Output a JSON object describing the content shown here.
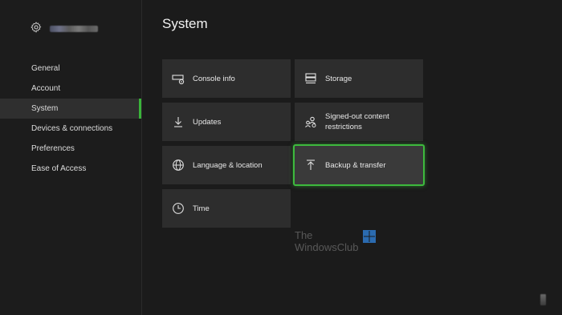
{
  "sidebar": {
    "items": [
      {
        "label": "General"
      },
      {
        "label": "Account"
      },
      {
        "label": "System",
        "active": true
      },
      {
        "label": "Devices & connections"
      },
      {
        "label": "Preferences"
      },
      {
        "label": "Ease of Access"
      }
    ]
  },
  "main": {
    "title": "System",
    "tiles": [
      {
        "label": "Console info",
        "icon": "console-info-icon"
      },
      {
        "label": "Storage",
        "icon": "storage-icon"
      },
      {
        "label": "Updates",
        "icon": "download-arrow-icon"
      },
      {
        "label": "Signed-out content restrictions",
        "icon": "people-restrictions-icon"
      },
      {
        "label": "Language & location",
        "icon": "globe-icon"
      },
      {
        "label": "Backup & transfer",
        "icon": "upload-arrow-icon",
        "selected": true
      },
      {
        "label": "Time",
        "icon": "clock-icon"
      }
    ]
  },
  "watermark": {
    "line1": "The",
    "line2": "WindowsClub"
  },
  "colors": {
    "accent": "#3dba3d",
    "background": "#1b1b1b",
    "tile": "#2d2d2d"
  }
}
